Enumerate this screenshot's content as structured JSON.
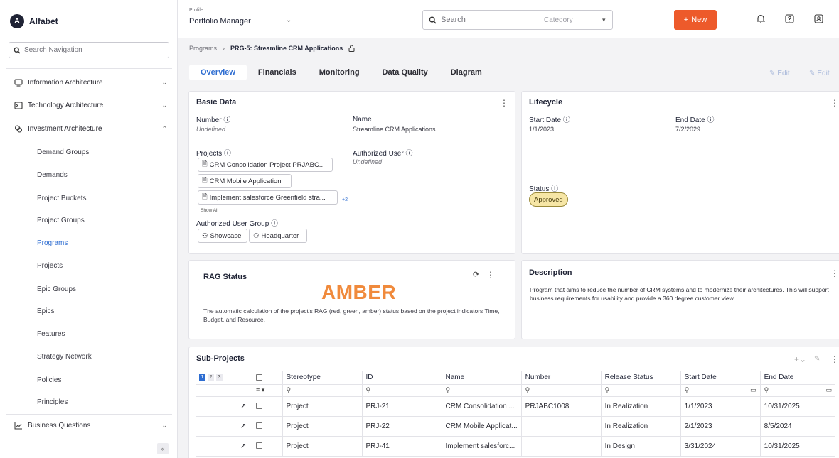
{
  "app": {
    "brand_letter": "A",
    "brand_name": "Alfabet"
  },
  "nav": {
    "search_placeholder": "Search Navigation",
    "sections": [
      {
        "label": "Information Architecture"
      },
      {
        "label": "Technology Architecture"
      },
      {
        "label": "Investment Architecture"
      }
    ],
    "investment_items": [
      "Demand Groups",
      "Demands",
      "Project Buckets",
      "Project Groups",
      "Programs",
      "Projects",
      "Epic Groups",
      "Epics",
      "Features",
      "Strategy Network",
      "Policies",
      "Principles"
    ],
    "bottom_section": "Business Questions",
    "collapse_label": "«"
  },
  "header": {
    "profile_caption": "Profile",
    "profile_name": "Portfolio Manager",
    "search_placeholder": "Search",
    "category_label": "Category",
    "new_label": "New"
  },
  "breadcrumb": {
    "parent": "Programs",
    "current": "PRG-5: Streamline CRM Applications"
  },
  "tabs": [
    "Overview",
    "Financials",
    "Monitoring",
    "Data Quality",
    "Diagram"
  ],
  "edit_label": "Edit",
  "basic": {
    "title": "Basic Data",
    "number_label": "Number",
    "number_value": "Undefined",
    "name_label": "Name",
    "name_value": "Streamline CRM Applications",
    "projects_label": "Projects",
    "projects": [
      "CRM Consolidation Project PRJABC...",
      "CRM Mobile Application",
      "Implement salesforce Greenfield stra..."
    ],
    "more_count": "+2",
    "show_all": "Show All",
    "auth_user_label": "Authorized User",
    "auth_user_value": "Undefined",
    "auth_group_label": "Authorized User Group",
    "groups": [
      "Showcase",
      "Headquarter"
    ]
  },
  "lifecycle": {
    "title": "Lifecycle",
    "start_label": "Start Date",
    "start_value": "1/1/2023",
    "end_label": "End Date",
    "end_value": "7/2/2029",
    "status_label": "Status",
    "status_value": "Approved"
  },
  "rag": {
    "title": "RAG Status",
    "value": "AMBER",
    "text": "The automatic calculation of the project's RAG (red, green, amber) status based on the project indicators Time, Budget, and Resource."
  },
  "description": {
    "title": "Description",
    "text": "Program that aims to reduce the number of CRM systems and to modernize their architectures. This will support business requirements for usability and provide a 360 degree customer view."
  },
  "subprojects": {
    "title": "Sub-Projects",
    "pages": [
      "1",
      "2",
      "3"
    ],
    "columns": [
      "Stereotype",
      "ID",
      "Name",
      "Number",
      "Release Status",
      "Start Date",
      "End Date"
    ],
    "rows": [
      {
        "stereotype": "Project",
        "id": "PRJ-21",
        "name": "CRM Consolidation ...",
        "number": "PRJABC1008",
        "release": "In Realization",
        "start": "1/1/2023",
        "end": "10/31/2025"
      },
      {
        "stereotype": "Project",
        "id": "PRJ-22",
        "name": "CRM Mobile Applicat...",
        "number": "",
        "release": "In Realization",
        "start": "2/1/2023",
        "end": "8/5/2024"
      },
      {
        "stereotype": "Project",
        "id": "PRJ-41",
        "name": "Implement salesforc...",
        "number": "",
        "release": "In Design",
        "start": "3/31/2024",
        "end": "10/31/2025"
      }
    ]
  },
  "colors": {
    "accent": "#2e6dd1",
    "new_button": "#ed5a2b",
    "amber": "#f08a3c",
    "status_bg": "#f6e6a6"
  }
}
